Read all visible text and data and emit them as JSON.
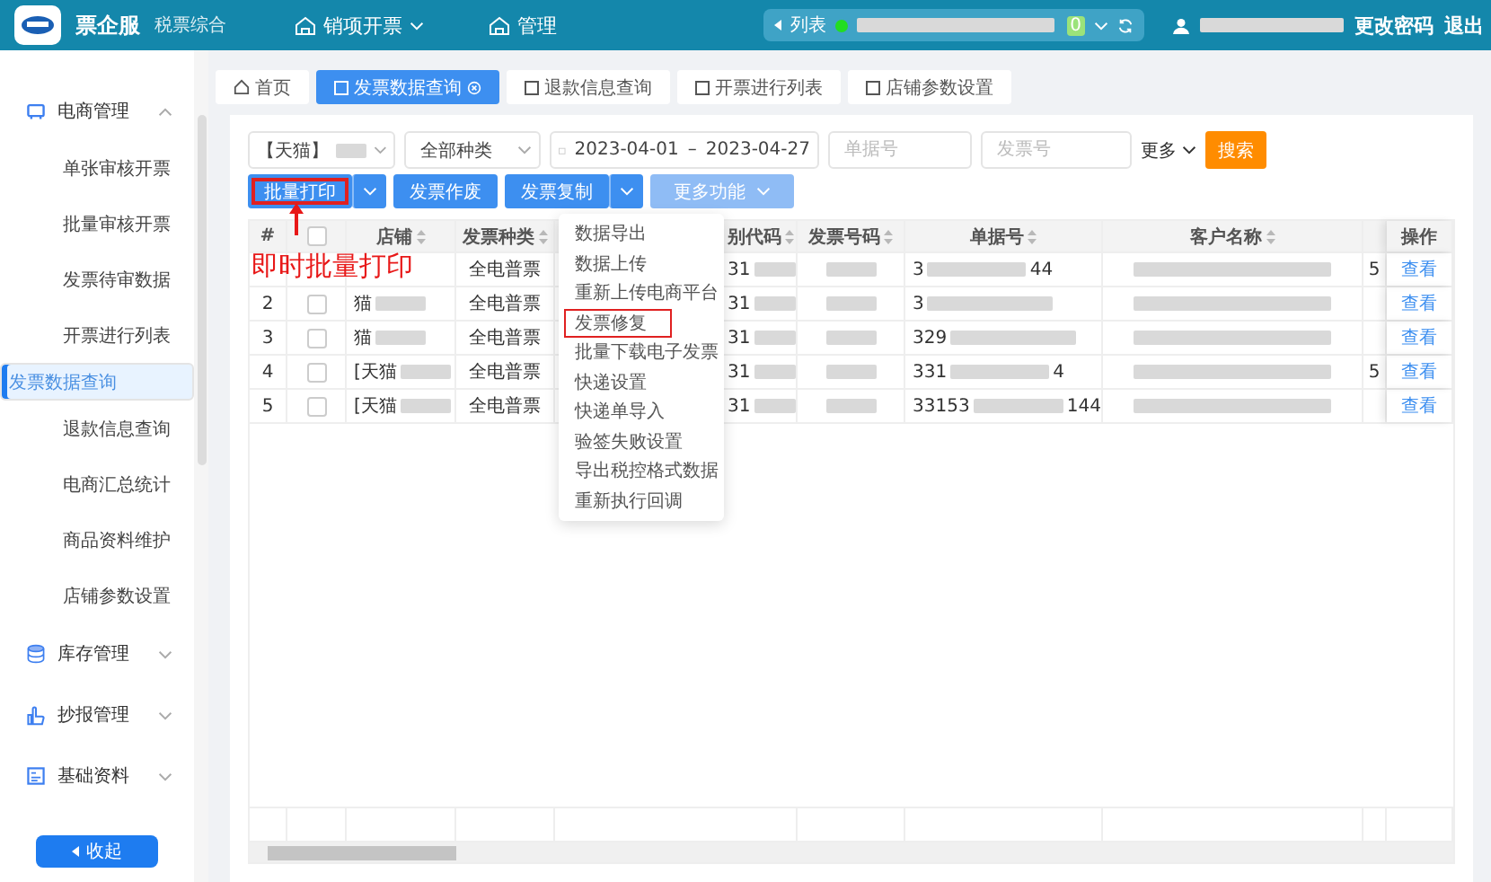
{
  "header": {
    "brand": "票企服",
    "subtitle": "税票综合",
    "nav": [
      {
        "label": "销项开票",
        "has_caret": true
      },
      {
        "label": "管理",
        "has_caret": false
      }
    ],
    "list_label": "列表",
    "badge": "0",
    "change_password": "更改密码",
    "logout": "退出"
  },
  "sidebar": {
    "groups": [
      {
        "label": "电商管理",
        "expanded": true,
        "children": [
          {
            "label": "单张审核开票",
            "selected": false
          },
          {
            "label": "批量审核开票",
            "selected": false
          },
          {
            "label": "发票待审数据",
            "selected": false
          },
          {
            "label": "开票进行列表",
            "selected": false
          },
          {
            "label": "发票数据查询",
            "selected": true
          },
          {
            "label": "退款信息查询",
            "selected": false
          },
          {
            "label": "电商汇总统计",
            "selected": false
          },
          {
            "label": "商品资料维护",
            "selected": false
          },
          {
            "label": "店铺参数设置",
            "selected": false
          }
        ]
      },
      {
        "label": "库存管理",
        "expanded": false
      },
      {
        "label": "抄报管理",
        "expanded": false
      },
      {
        "label": "基础资料",
        "expanded": false
      }
    ],
    "collapse_button": "收起"
  },
  "tabs": [
    {
      "label": "首页",
      "selected": false
    },
    {
      "label": "发票数据查询",
      "selected": true
    },
    {
      "label": "退款信息查询",
      "selected": false
    },
    {
      "label": "开票进行列表",
      "selected": false
    },
    {
      "label": "店铺参数设置",
      "selected": false
    }
  ],
  "filters": {
    "shop": "【天猫】",
    "type": "全部种类",
    "date_from": "2023-04-01",
    "date_sep": "–",
    "date_to": "2023-04-27",
    "order_placeholder": "单据号",
    "invoice_placeholder": "发票号",
    "more": "更多",
    "search": "搜索"
  },
  "actions": [
    {
      "label": "批量打印",
      "split": true,
      "highlighted": true,
      "disabled": false
    },
    {
      "label": "发票作废",
      "split": false,
      "highlighted": false,
      "disabled": false
    },
    {
      "label": "发票复制",
      "split": true,
      "highlighted": false,
      "disabled": false
    },
    {
      "label": "更多功能",
      "split": false,
      "highlighted": false,
      "disabled": true
    }
  ],
  "annotation": "即时批量打印",
  "table": {
    "all_checked": false,
    "columns": [
      "#",
      "",
      "店铺",
      "发票种类",
      "别代码",
      "发票号码",
      "单据号",
      "客户名称",
      "",
      "操作"
    ],
    "rows": [
      {
        "type": "全电普票",
        "code": "31",
        "doc_head": "3",
        "doc_tail": "44",
        "extra": "5",
        "action": "查看"
      },
      {
        "index": "2",
        "checked": false,
        "shop": "猫",
        "type": "全电普票",
        "code": "31",
        "doc_head": "3",
        "doc_tail": "",
        "extra": "",
        "action": "查看"
      },
      {
        "index": "3",
        "checked": false,
        "shop": "猫",
        "type": "全电普票",
        "code": "31",
        "doc_head": "329",
        "doc_tail": "",
        "extra": "",
        "action": "查看"
      },
      {
        "index": "4",
        "checked": false,
        "shop": "[天猫",
        "type": "全电普票",
        "code": "31",
        "doc_head": "331",
        "doc_tail": "4",
        "extra": "5",
        "action": "查看"
      },
      {
        "index": "5",
        "checked": false,
        "shop": "[天猫",
        "type": "全电普票",
        "code": "31",
        "doc_head": "33153",
        "doc_tail": "144",
        "extra": "",
        "action": "查看"
      }
    ]
  },
  "menu": {
    "items": [
      {
        "label": "数据导出",
        "highlighted": false
      },
      {
        "label": "数据上传",
        "highlighted": false
      },
      {
        "label": "重新上传电商平台",
        "highlighted": false
      },
      {
        "label": "发票修复",
        "highlighted": true
      },
      {
        "label": "批量下载电子发票",
        "highlighted": false
      },
      {
        "label": "快递设置",
        "highlighted": false
      },
      {
        "label": "快递单导入",
        "highlighted": false
      },
      {
        "label": "验签失败设置",
        "highlighted": false
      },
      {
        "label": "导出税控格式数据",
        "highlighted": false
      },
      {
        "label": "重新执行回调",
        "highlighted": false
      }
    ]
  }
}
